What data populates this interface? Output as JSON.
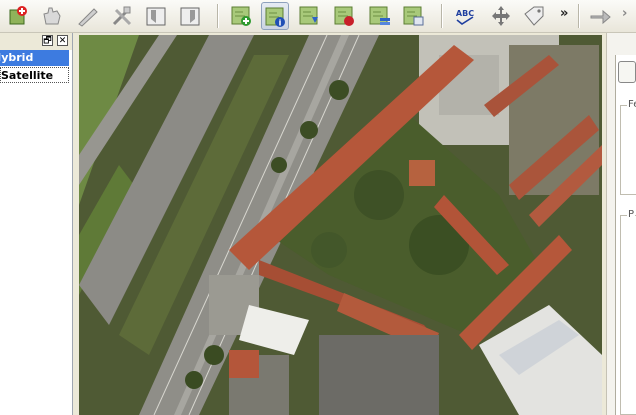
{
  "toolbar": {
    "icons": [
      "add-layer-icon",
      "pan-icon",
      "measure-icon",
      "tools-icon",
      "layer-left-icon",
      "layer-right-icon",
      "map-add-icon",
      "map-info-icon",
      "map-download-icon",
      "map-bookmark-icon",
      "map-layers-icon",
      "map-stack-icon",
      "spell-check-icon",
      "move-tool-icon",
      "tag-icon",
      "more-icon",
      "navigate-icon"
    ],
    "active_icon": "map-info-icon",
    "more_label": "»",
    "spell_label": "ABC"
  },
  "left_panel": {
    "restore_label": "🗗",
    "close_label": "✕",
    "layers": [
      {
        "label": "Hybrid",
        "selected": true
      },
      {
        "label": "Satellite",
        "selected": false
      }
    ]
  },
  "right_panel": {
    "group1_label": "Fe",
    "group2_label": "P"
  },
  "colors": {
    "selection": "#3d7be0",
    "roof": "#b5573a",
    "vegetation": "#4a5d2c"
  }
}
